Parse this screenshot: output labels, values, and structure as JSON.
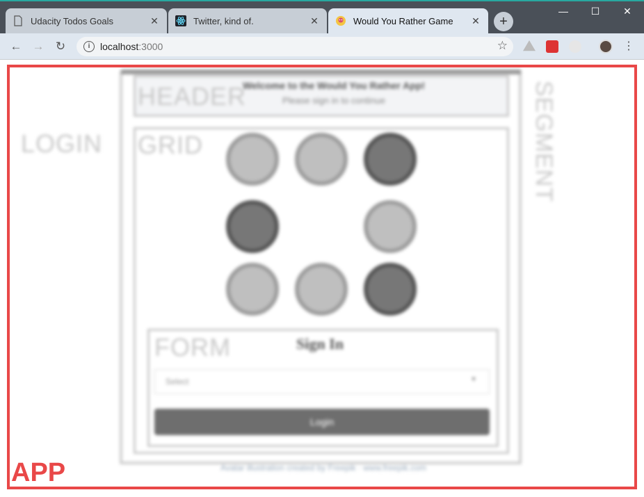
{
  "browser": {
    "tabs": [
      {
        "title": "Udacity Todos Goals",
        "icon": "page-icon",
        "active": false
      },
      {
        "title": "Twitter, kind of.",
        "icon": "react-icon",
        "active": false
      },
      {
        "title": "Would You Rather Game",
        "icon": "game-icon",
        "active": true
      }
    ],
    "new_tab_label": "+",
    "window_controls": {
      "minimize": "—",
      "maximize": "☐",
      "close": "✕"
    },
    "address": {
      "host": "localhost",
      "port": ":3000"
    },
    "nav": {
      "back": "←",
      "forward": "→",
      "reload": "↻"
    },
    "star": "☆",
    "menu": "⋮",
    "info": "i"
  },
  "page": {
    "header_title": "Welcome to the Would You Rather App!",
    "header_subtitle": "Please sign in to continue",
    "form_title": "Sign In",
    "select_placeholder": "Select",
    "select_caret": "▾",
    "login_button": "Login",
    "footer": "Avatar illustration created by Freepik · www.freepik.com"
  },
  "annotations": {
    "app": "APP",
    "login": "LOGIN",
    "header": "HEADER",
    "grid": "GRID",
    "segment": "SEGMENT",
    "form": "FORM"
  },
  "colors": {
    "annotation_red": "#e94848",
    "titlebar": "#4a5058",
    "login_button": "#6e6e6e"
  }
}
